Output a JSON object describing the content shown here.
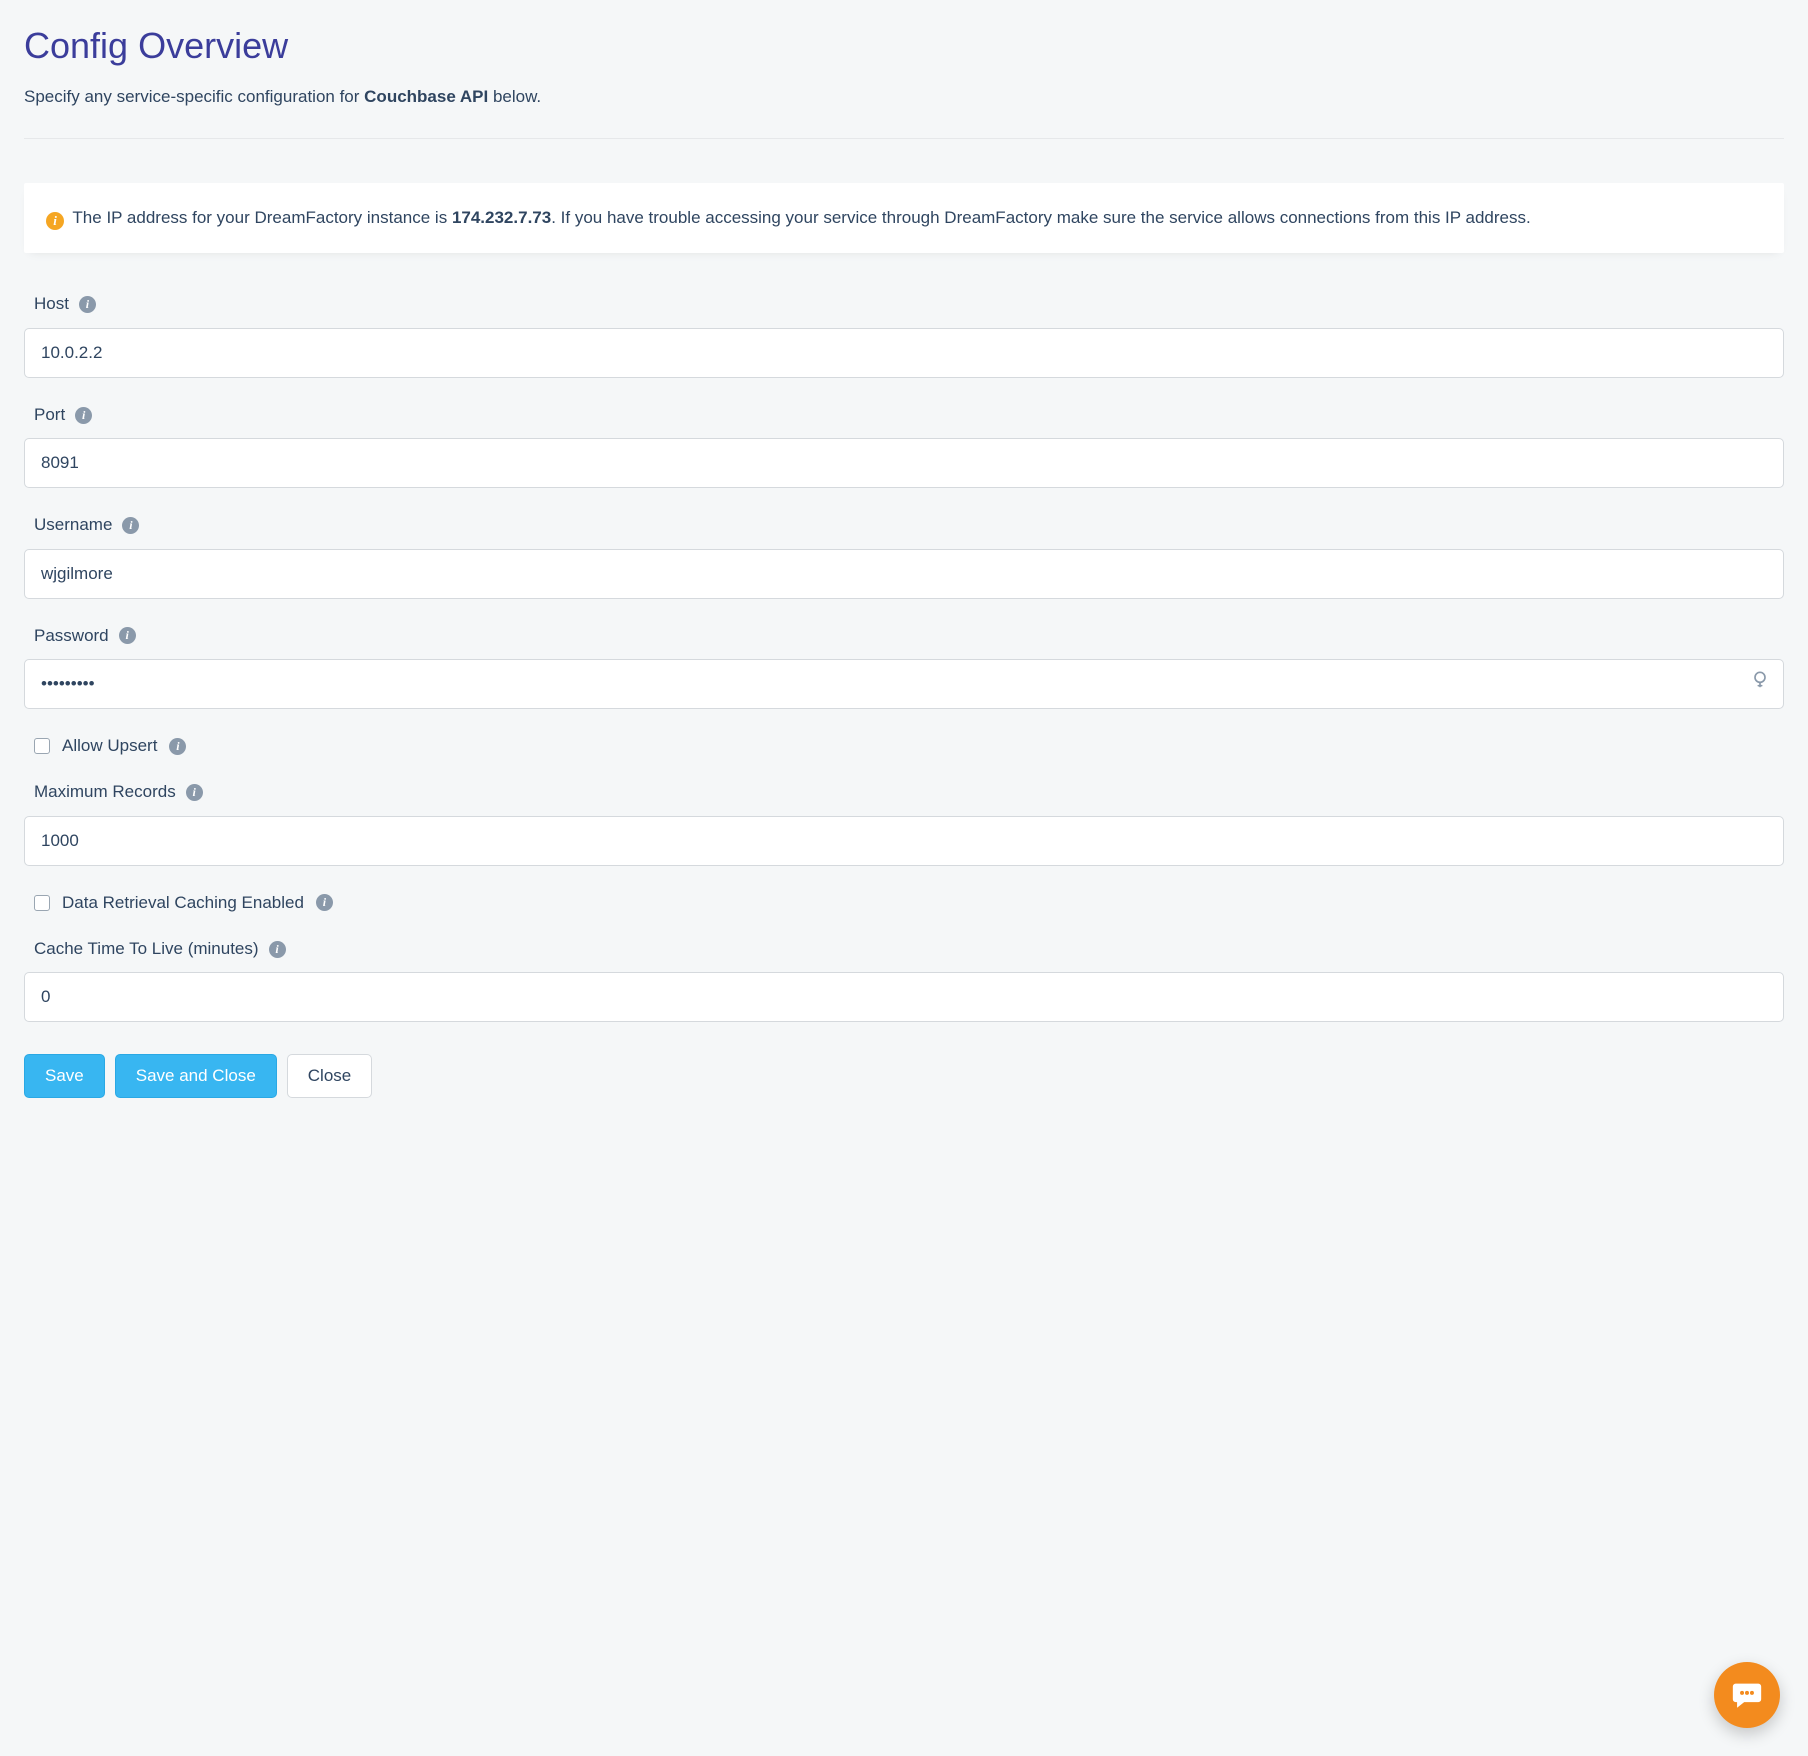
{
  "header": {
    "title": "Config Overview",
    "subtitle_pre": "Specify any service-specific configuration for ",
    "subtitle_strong": "Couchbase API",
    "subtitle_post": " below."
  },
  "info": {
    "pre": "The IP address for your DreamFactory instance is ",
    "ip": "174.232.7.73",
    "post": ". If you have trouble accessing your service through DreamFactory make sure the service allows connections from this IP address."
  },
  "fields": {
    "host": {
      "label": "Host",
      "value": "10.0.2.2"
    },
    "port": {
      "label": "Port",
      "value": "8091"
    },
    "username": {
      "label": "Username",
      "value": "wjgilmore"
    },
    "password": {
      "label": "Password",
      "value": "•••••••••"
    },
    "allow_upsert": {
      "label": "Allow Upsert",
      "checked": false
    },
    "max_records": {
      "label": "Maximum Records",
      "value": "1000"
    },
    "caching_enabled": {
      "label": "Data Retrieval Caching Enabled",
      "checked": false
    },
    "cache_ttl": {
      "label": "Cache Time To Live (minutes)",
      "value": "0"
    }
  },
  "buttons": {
    "save": "Save",
    "save_close": "Save and Close",
    "close": "Close"
  }
}
